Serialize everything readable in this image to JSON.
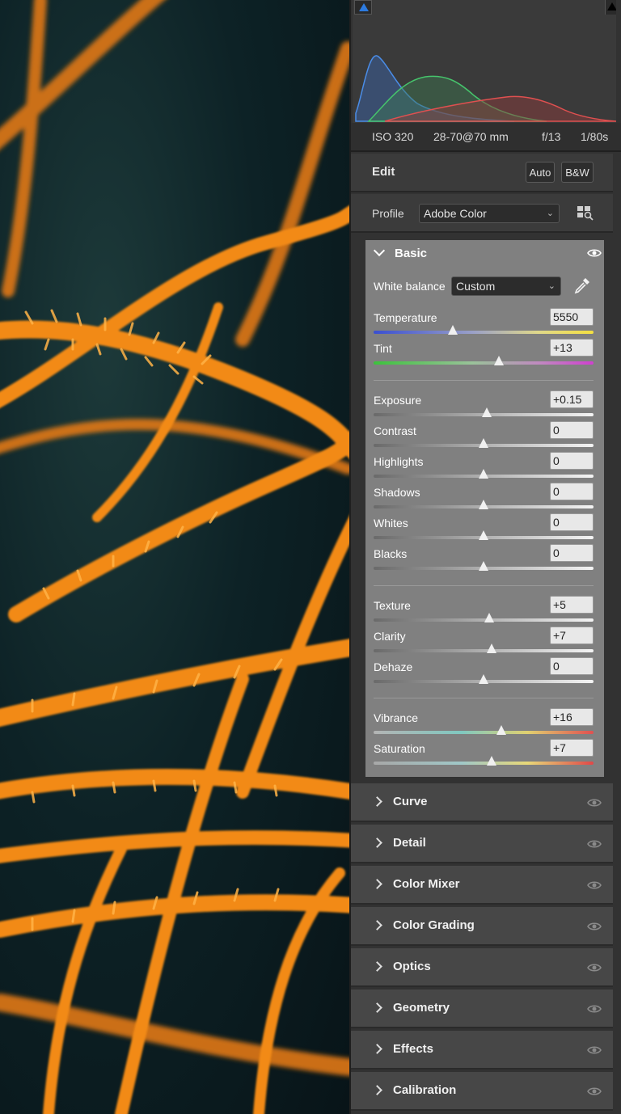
{
  "exif": {
    "iso": "ISO 320",
    "lens": "28-70@70 mm",
    "aperture": "f/13",
    "shutter": "1/80s"
  },
  "edit": {
    "title": "Edit",
    "auto_label": "Auto",
    "bw_label": "B&W"
  },
  "profile": {
    "label": "Profile",
    "value": "Adobe Color"
  },
  "basic": {
    "title": "Basic",
    "white_balance_label": "White balance",
    "white_balance_value": "Custom",
    "sliders": [
      {
        "label": "Temperature",
        "value": "5550",
        "level": 0.36,
        "track": "temp"
      },
      {
        "label": "Tint",
        "value": "+13",
        "level": 0.57,
        "track": "tint"
      },
      {
        "label": "Exposure",
        "value": "+0.15",
        "level": 0.515,
        "track": "gray"
      },
      {
        "label": "Contrast",
        "value": "0",
        "level": 0.5,
        "track": "gray"
      },
      {
        "label": "Highlights",
        "value": "0",
        "level": 0.5,
        "track": "gray"
      },
      {
        "label": "Shadows",
        "value": "0",
        "level": 0.5,
        "track": "gray"
      },
      {
        "label": "Whites",
        "value": "0",
        "level": 0.5,
        "track": "gray"
      },
      {
        "label": "Blacks",
        "value": "0",
        "level": 0.5,
        "track": "gray"
      },
      {
        "label": "Texture",
        "value": "+5",
        "level": 0.525,
        "track": "gray"
      },
      {
        "label": "Clarity",
        "value": "+7",
        "level": 0.535,
        "track": "gray"
      },
      {
        "label": "Dehaze",
        "value": "0",
        "level": 0.5,
        "track": "gray"
      },
      {
        "label": "Vibrance",
        "value": "+16",
        "level": 0.58,
        "track": "vib"
      },
      {
        "label": "Saturation",
        "value": "+7",
        "level": 0.535,
        "track": "sat"
      }
    ]
  },
  "sections": [
    "Curve",
    "Detail",
    "Color Mixer",
    "Color Grading",
    "Optics",
    "Geometry",
    "Effects",
    "Calibration"
  ],
  "icons": {
    "eye": "eye-icon",
    "eyedropper": "eyedropper-icon",
    "presets": "profile-browser-icon"
  },
  "colors": {
    "panel": "#323232",
    "basic_bg": "#808080",
    "section_bg": "#474747"
  }
}
